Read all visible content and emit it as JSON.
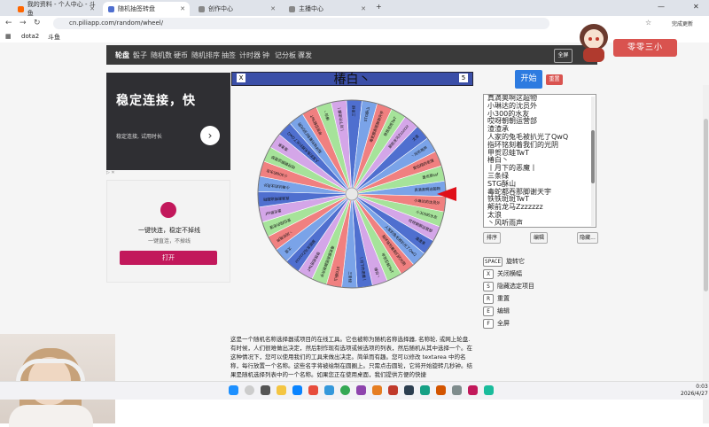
{
  "browser": {
    "tabs": [
      {
        "label": "我的资料 - 个人中心 - 斗鱼",
        "active": false
      },
      {
        "label": "随机抽签转盘",
        "active": true
      },
      {
        "label": "创作中心",
        "active": false
      },
      {
        "label": "主播中心",
        "active": false
      }
    ],
    "url": "cn.piliapp.com/random/wheel/",
    "update_label": "完成更新",
    "bookmarks": [
      "dota2",
      "斗鱼"
    ]
  },
  "site_nav": {
    "items": [
      "轮盘",
      "骰子",
      "随机数",
      "硬币",
      "随机排序",
      "抽签",
      "计时器",
      "钟",
      "记分板",
      "骤发"
    ],
    "fullscreen_label": "全屏"
  },
  "wheel": {
    "title": "椿白丶",
    "close_key": "X",
    "count_key": "5",
    "slice_colors": [
      "#7aa3e8",
      "#f08080",
      "#a6e39a",
      "#d4a6e8",
      "#4f6fcf"
    ]
  },
  "controls": {
    "spin_label": "开始",
    "reset_label": "重置",
    "names": [
      "真滴奥啊这超物",
      "小琳达的沈员外",
      "小300的水友",
      "哎呀朝朝运营部",
      "渣渣承",
      "人家的兔毛被扒光了QwQ",
      "指环铭刻着我们的光阴",
      "甲贺忍蛙TwT",
      "椿白丶",
      "丨月下的恶魔丨",
      "三条绿",
      "STG酥山",
      "毒蛇都吞那脚谢天宇",
      "铁铁斑斑TwT",
      "颠前龙马Zzzzzzz",
      "太浪",
      "丶风听雨声",
      "爱拉翔的老馒",
      "墨也那ssf"
    ],
    "sort_label": "排序",
    "edit_label": "编辑",
    "hide_label": "隐藏..."
  },
  "shortcuts": [
    {
      "key": "SPACE",
      "label": "旋转它"
    },
    {
      "key": "X",
      "label": "关闭横幅"
    },
    {
      "key": "S",
      "label": "隐藏选定项目"
    },
    {
      "key": "R",
      "label": "重置"
    },
    {
      "key": "E",
      "label": "编辑"
    },
    {
      "key": "F",
      "label": "全屏"
    }
  ],
  "ads": {
    "ad1_title": "稳定连接，快",
    "ad1_sub": "稳定连接, 试用时长",
    "ad2_line1": "一键快连，稳定不掉线",
    "ad2_line2": "一键直连，不掉线",
    "ad2_button": "打开"
  },
  "description": "这是一个随机名称选择器或项目的在线工具。它也被称为随机名称选择器, 名称轮, 或网上轮盘. 有时候，人们很难做出决定，然后制作现有选项或候选项的列表，然后随机从其中选择一个。在这种情况下，您可以使用我们的工具来做出决定。简单而有趣。您可以修改 textarea 中的名称，每行放置一个名称。这些名字将被绘制在圆圈上。只需点击圆轮，它将开始旋转几秒钟。结果是随机选择列表中的一个名称。如果您正在使用桌面，我们提供方便的快捷",
  "streamer_label": "零零三小",
  "clock": {
    "time": "0:03",
    "date": "2026/4/27"
  }
}
